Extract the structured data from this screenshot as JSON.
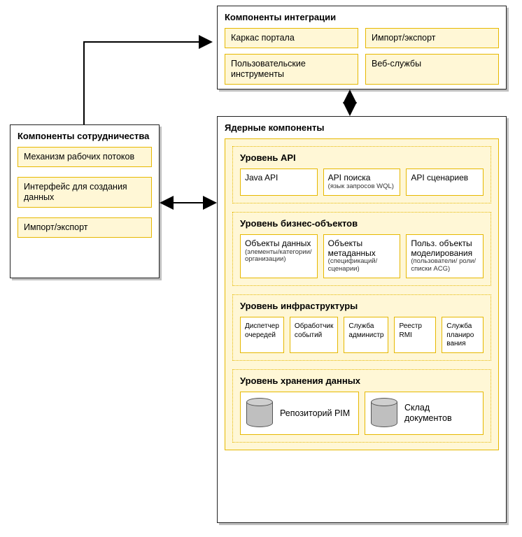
{
  "integration": {
    "title": "Компоненты интеграции",
    "items": [
      "Каркас портала",
      "Импорт/экспорт",
      "Пользовательские инструменты",
      "Веб-службы"
    ]
  },
  "collaboration": {
    "title": "Компоненты сотрудничества",
    "items": [
      "Механизм рабочих потоков",
      "Интерфейс для создания данных",
      "Импорт/экспорт"
    ]
  },
  "core": {
    "title": "Ядерные компоненты",
    "tiers": {
      "api": {
        "title": "Уровень API",
        "items": [
          {
            "main": "Java API",
            "small": ""
          },
          {
            "main": "API поиска",
            "small": "(язык запросов WQL)"
          },
          {
            "main": "API сценариев",
            "small": ""
          }
        ]
      },
      "business": {
        "title": "Уровень бизнес-объектов",
        "items": [
          {
            "main": "Объекты данных",
            "small": "(элементы/категории/ организации)"
          },
          {
            "main": "Объекты метаданных",
            "small": "(спецификаций/ сценарии)"
          },
          {
            "main": "Польз. объекты моделирования",
            "small": "(пользователи/ роли/списки ACG)"
          }
        ]
      },
      "infra": {
        "title": "Уровень инфраструктуры",
        "items": [
          {
            "main": "Диспетчер очередей"
          },
          {
            "main": "Обработчик событий"
          },
          {
            "main": "Служба администр"
          },
          {
            "main": "Реестр RMI"
          },
          {
            "main": "Служба планиро вания"
          }
        ]
      },
      "storage": {
        "title": "Уровень хранения данных",
        "items": [
          "Репозиторий PIM",
          "Склад документов"
        ]
      }
    }
  }
}
